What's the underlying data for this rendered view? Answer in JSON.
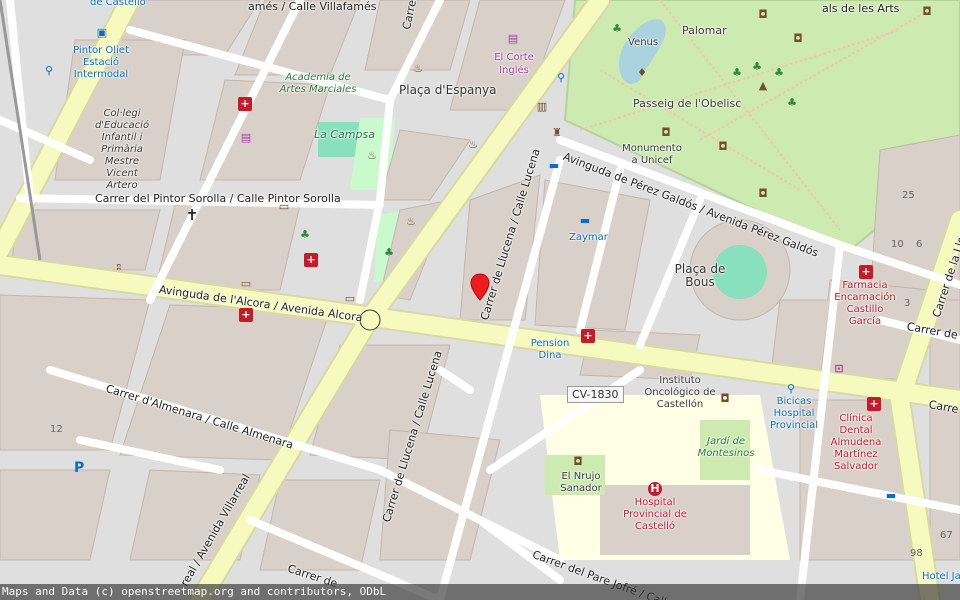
{
  "attribution": "Maps and Data (c) openstreetmap.org and contributors, ODbL",
  "roads": {
    "villafames": "amés / Calle Villafamés",
    "borriol": "Carrer de Borri",
    "pintor_sorolla": "Carrer del Pintor Sorolla / Calle Pintor Sorolla",
    "alcora": "Avinguda de l'Alcora / Avenida Alcora",
    "almenara": "Carrer d'Almenara / Calle Almenara",
    "villarreal": "real / Avenida Villarreal",
    "llucena_north": "Carrer de Llucena / Calle Lucena",
    "llucena_south": "Carrer de Llucena / Calle Lucena",
    "perez_galdos": "Avinguda de Pérez Galdós / Avenida Pérez Galdós",
    "lloma": "Carrer de la Lloma",
    "pare_jofre": "Carrer del Pare Jofré / Calle",
    "sud": "Carrer de",
    "arts": "als de les Arts",
    "east_right": "Carre",
    "east_right2": "Carrer de",
    "road_ref": "CV-1830",
    "bottom_left_road": "Carrer de"
  },
  "places": {
    "placa_espanya": "Plaça d'Espanya",
    "placa_bous": "Plaça de Bous",
    "la_campsa": "La Campsa",
    "academia": "Academia de Artes Marciales",
    "el_corte_ingles": "El Corte Inglés",
    "pintor_oliet": "Pintor Oliet Estació Intermodal",
    "estacio_top": "de Castelló",
    "col_legi": "Col·legi d'Educació Infantil i Primària Mestre Vicent Artero",
    "zaymar": "Zaymar",
    "pension_dina": "Pension Dina",
    "palomar": "Palomar",
    "venus": "Venus",
    "passeig_obelisc": "Passeig de l'Obelisc",
    "monumento_unicef": "Monumento a Unicef",
    "instituto": "Instituto Oncológico de Castellón",
    "jardi_montesinos": "Jardí de Montesinos",
    "el_nrujo": "El Nrujo Sanador",
    "hospital": "Hospital Provincial de Castelló",
    "bicicas": "Bicicas Hospital Provincial",
    "farmacia": "Farmacia Encarnación Castillo García",
    "clinica": "Clínica Dental Almudena Martínez Salvador",
    "hotel": "Hotel Jai",
    "numbers": [
      "25",
      "10",
      "6",
      "3",
      "12",
      "98",
      "67"
    ]
  },
  "colors": {
    "road_major": "#f7fabf",
    "road_major_casing": "#d8d9a3",
    "road_minor": "#ffffff",
    "building": "#d9d0c9",
    "park": "#c8facc",
    "hospital_area": "#ffffe5",
    "water": "#aad3df"
  },
  "icons": {
    "marker": "location-pin-icon",
    "parking": "P"
  }
}
